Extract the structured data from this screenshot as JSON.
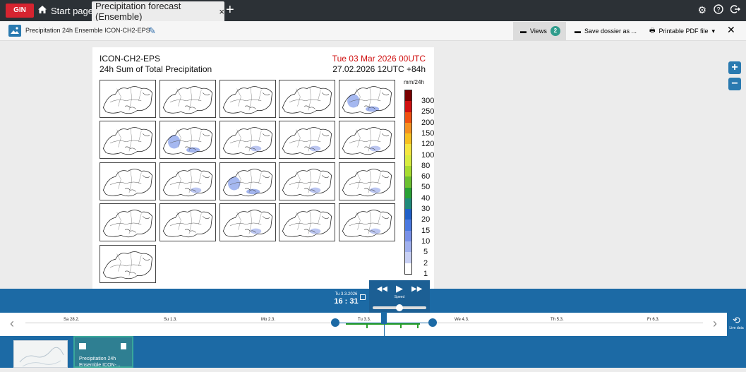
{
  "topbar": {
    "brand": "GIN",
    "start_tab": "Start page",
    "active_tab": "Precipitation forecast (Ensemble)",
    "add_tab": "+"
  },
  "subbar": {
    "title": "Precipitation 24h Ensemble ICON-CH2-EPS",
    "views_label": "Views",
    "views_count": "2",
    "save_label": "Save dossier as ...",
    "pdf_label": "Printable PDF file"
  },
  "figure": {
    "model": "ICON-CH2-EPS",
    "product": "24h Sum of Total Precipitation",
    "valid_time": "Tue 03 Mar 2026 00UTC",
    "run_time": "27.02.2026 12UTC +84h",
    "unit": "mm/24h",
    "colorbar_labels": [
      "300",
      "250",
      "200",
      "150",
      "120",
      "100",
      "80",
      "60",
      "50",
      "40",
      "30",
      "20",
      "15",
      "10",
      "5",
      "2",
      "1"
    ],
    "colorbar_colors": [
      "#7a0000",
      "#d01010",
      "#f05010",
      "#f59020",
      "#f7c020",
      "#f5e640",
      "#d8ec40",
      "#a8dc30",
      "#6cc030",
      "#2aa035",
      "#208a7a",
      "#2060c8",
      "#4a78e0",
      "#7890e8",
      "#a0b0ee",
      "#c8d0f4",
      "#ffffff"
    ],
    "member_count": 21
  },
  "time": {
    "date": "Tu 3.3.2026",
    "clock": "16 : 31",
    "speed_label": "Speed"
  },
  "timeline": {
    "days": [
      "Sa 28.2.",
      "Su 1.3.",
      "Mo 2.3.",
      "Tu 3.3.",
      "We 4.3.",
      "Th 5.3.",
      "Fr 6.3."
    ],
    "live_label": "Live data"
  },
  "dossier": {
    "item_label_1": "Precipitation 24h",
    "item_label_2": "Ensemble ICON-..."
  }
}
